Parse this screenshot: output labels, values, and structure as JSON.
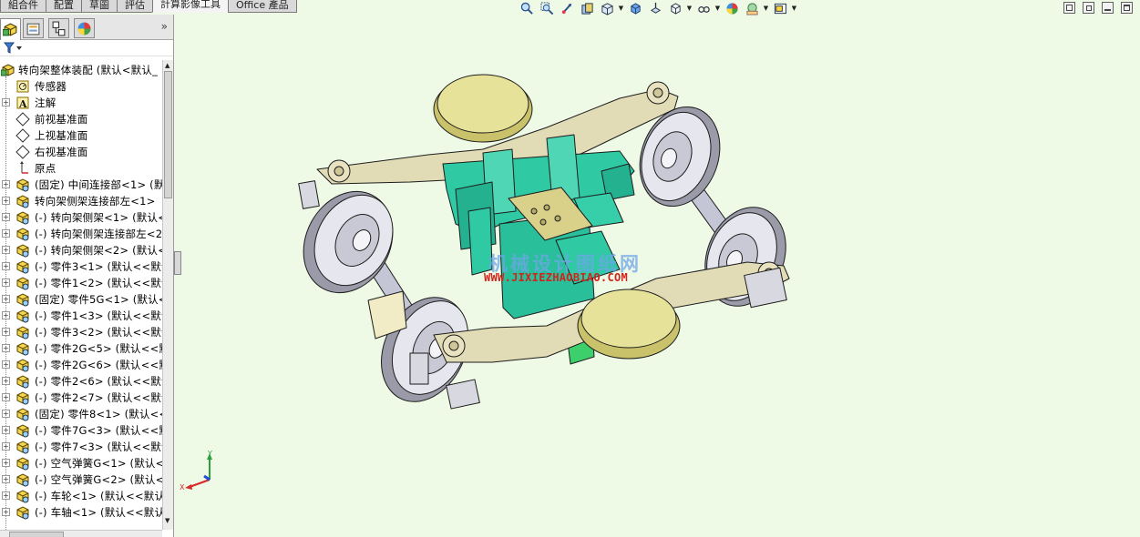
{
  "command_tabs": [
    {
      "label": "組合件",
      "active": false
    },
    {
      "label": "配置",
      "active": false
    },
    {
      "label": "草圖",
      "active": false
    },
    {
      "label": "評估",
      "active": false
    },
    {
      "label": "計算影像工具",
      "active": true
    },
    {
      "label": "Office 產品",
      "active": false
    }
  ],
  "hud_icons": [
    "zoom-to-fit-icon",
    "zoom-to-area-icon",
    "previous-view-icon",
    "section-view-icon",
    "view-orientation-icon",
    "display-style-icon",
    "hide-show-icon",
    "edit-appearance-icon",
    "apply-scene-icon",
    "view-settings-icon"
  ],
  "panel_tabs": [
    "feature-manager-tab",
    "property-manager-tab",
    "configuration-manager-tab",
    "display-manager-tab"
  ],
  "panel_expand": "»",
  "tree": [
    {
      "label": "转向架整体装配 (默认<默认_",
      "icon": "assembly",
      "expandable": false
    },
    {
      "label": "传感器",
      "icon": "sensor",
      "expandable": false
    },
    {
      "label": "注解",
      "icon": "annotation",
      "expandable": true
    },
    {
      "label": "前视基准面",
      "icon": "plane",
      "expandable": false
    },
    {
      "label": "上视基准面",
      "icon": "plane",
      "expandable": false
    },
    {
      "label": "右视基准面",
      "icon": "plane",
      "expandable": false
    },
    {
      "label": "原点",
      "icon": "origin",
      "expandable": false
    },
    {
      "label": "(固定) 中间连接部<1> (默",
      "icon": "part",
      "expandable": true
    },
    {
      "label": "转向架侧架连接部左<1>",
      "icon": "part",
      "expandable": true
    },
    {
      "label": "(-) 转向架侧架<1> (默认<",
      "icon": "part",
      "expandable": true
    },
    {
      "label": "(-) 转向架侧架连接部左<2",
      "icon": "part",
      "expandable": true
    },
    {
      "label": "(-) 转向架侧架<2> (默认<",
      "icon": "part",
      "expandable": true
    },
    {
      "label": "(-) 零件3<1> (默认<<默认",
      "icon": "part",
      "expandable": true
    },
    {
      "label": "(-) 零件1<2> (默认<<默认",
      "icon": "part",
      "expandable": true
    },
    {
      "label": "(固定) 零件5G<1> (默认<",
      "icon": "part",
      "expandable": true
    },
    {
      "label": "(-) 零件1<3> (默认<<默认",
      "icon": "part",
      "expandable": true
    },
    {
      "label": "(-) 零件3<2> (默认<<默认",
      "icon": "part",
      "expandable": true
    },
    {
      "label": "(-) 零件2G<5> (默认<<默",
      "icon": "part",
      "expandable": true
    },
    {
      "label": "(-) 零件2G<6> (默认<<默",
      "icon": "part",
      "expandable": true
    },
    {
      "label": "(-) 零件2<6> (默认<<默认",
      "icon": "part",
      "expandable": true
    },
    {
      "label": "(-) 零件2<7> (默认<<默认",
      "icon": "part",
      "expandable": true
    },
    {
      "label": "(固定) 零件8<1> (默认<<",
      "icon": "part",
      "expandable": true
    },
    {
      "label": "(-) 零件7G<3> (默认<<默",
      "icon": "part",
      "expandable": true
    },
    {
      "label": "(-) 零件7<3> (默认<<默认",
      "icon": "part",
      "expandable": true
    },
    {
      "label": "(-) 空气弹簧G<1> (默认<",
      "icon": "part",
      "expandable": true
    },
    {
      "label": "(-) 空气弹簧G<2> (默认<",
      "icon": "part",
      "expandable": true
    },
    {
      "label": "(-) 车轮<1> (默认<<默认",
      "icon": "part",
      "expandable": true
    },
    {
      "label": "(-) 车轴<1> (默认<<默认",
      "icon": "part",
      "expandable": true
    }
  ],
  "watermark": {
    "title": "机械设计图纸网",
    "url": "WWW.JIXIEZHAOBIAO.COM"
  },
  "triad": {
    "x": "X",
    "y": "Y"
  },
  "colors": {
    "background": "#eef9e6",
    "frame": "#e2dcb6",
    "pad": "#e7e29a",
    "bolster": "#2fc9a4",
    "wheel": "#d8d8e2",
    "axle": "#b9b9cc",
    "watermark_url": "#d2231c"
  }
}
